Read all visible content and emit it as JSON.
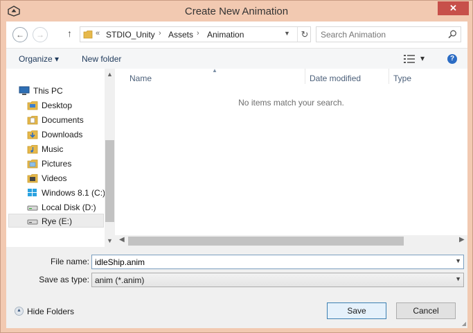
{
  "window": {
    "title": "Create New Animation",
    "close_glyph": "✕"
  },
  "nav": {
    "back": "←",
    "forward": "→",
    "up": "↑",
    "breadcrumb_overflow": "«",
    "breadcrumb": [
      "STDIO_Unity",
      "Assets",
      "Animation"
    ],
    "refresh": "↻",
    "search_placeholder": "Search Animation"
  },
  "toolbar": {
    "organize": "Organize ▾",
    "new_folder": "New folder",
    "view_dropdown": "▾",
    "help": "?"
  },
  "tree": [
    {
      "label": "This PC",
      "icon": "computer-icon"
    },
    {
      "label": "Desktop",
      "icon": "folder-icon"
    },
    {
      "label": "Documents",
      "icon": "folder-icon"
    },
    {
      "label": "Downloads",
      "icon": "folder-download-icon"
    },
    {
      "label": "Music",
      "icon": "folder-music-icon"
    },
    {
      "label": "Pictures",
      "icon": "folder-pictures-icon"
    },
    {
      "label": "Videos",
      "icon": "folder-videos-icon"
    },
    {
      "label": "Windows 8.1 (C:)",
      "icon": "windows-drive-icon"
    },
    {
      "label": "Local Disk (D:)",
      "icon": "drive-icon"
    },
    {
      "label": "Rye (E:)",
      "icon": "drive-icon",
      "selected": true
    }
  ],
  "list": {
    "columns": [
      "Name",
      "Date modified",
      "Type"
    ],
    "empty_message": "No items match your search."
  },
  "form": {
    "file_name_label": "File name:",
    "file_name_value": "idleShip.anim",
    "save_type_label": "Save as type:",
    "save_type_value": "anim (*.anim)"
  },
  "footer": {
    "hide_folders": "Hide Folders",
    "save": "Save",
    "cancel": "Cancel"
  },
  "colors": {
    "title_bar": "#f2c9b1",
    "close": "#c7504a",
    "accent": "#3c7fb1"
  }
}
